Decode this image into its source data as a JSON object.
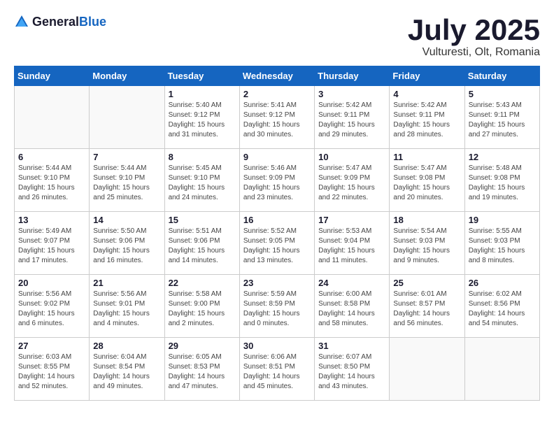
{
  "header": {
    "logo_general": "General",
    "logo_blue": "Blue",
    "month_title": "July 2025",
    "location": "Vulturesti, Olt, Romania"
  },
  "days_of_week": [
    "Sunday",
    "Monday",
    "Tuesday",
    "Wednesday",
    "Thursday",
    "Friday",
    "Saturday"
  ],
  "weeks": [
    [
      {
        "day": "",
        "info": ""
      },
      {
        "day": "",
        "info": ""
      },
      {
        "day": "1",
        "info": "Sunrise: 5:40 AM\nSunset: 9:12 PM\nDaylight: 15 hours\nand 31 minutes."
      },
      {
        "day": "2",
        "info": "Sunrise: 5:41 AM\nSunset: 9:12 PM\nDaylight: 15 hours\nand 30 minutes."
      },
      {
        "day": "3",
        "info": "Sunrise: 5:42 AM\nSunset: 9:11 PM\nDaylight: 15 hours\nand 29 minutes."
      },
      {
        "day": "4",
        "info": "Sunrise: 5:42 AM\nSunset: 9:11 PM\nDaylight: 15 hours\nand 28 minutes."
      },
      {
        "day": "5",
        "info": "Sunrise: 5:43 AM\nSunset: 9:11 PM\nDaylight: 15 hours\nand 27 minutes."
      }
    ],
    [
      {
        "day": "6",
        "info": "Sunrise: 5:44 AM\nSunset: 9:10 PM\nDaylight: 15 hours\nand 26 minutes."
      },
      {
        "day": "7",
        "info": "Sunrise: 5:44 AM\nSunset: 9:10 PM\nDaylight: 15 hours\nand 25 minutes."
      },
      {
        "day": "8",
        "info": "Sunrise: 5:45 AM\nSunset: 9:10 PM\nDaylight: 15 hours\nand 24 minutes."
      },
      {
        "day": "9",
        "info": "Sunrise: 5:46 AM\nSunset: 9:09 PM\nDaylight: 15 hours\nand 23 minutes."
      },
      {
        "day": "10",
        "info": "Sunrise: 5:47 AM\nSunset: 9:09 PM\nDaylight: 15 hours\nand 22 minutes."
      },
      {
        "day": "11",
        "info": "Sunrise: 5:47 AM\nSunset: 9:08 PM\nDaylight: 15 hours\nand 20 minutes."
      },
      {
        "day": "12",
        "info": "Sunrise: 5:48 AM\nSunset: 9:08 PM\nDaylight: 15 hours\nand 19 minutes."
      }
    ],
    [
      {
        "day": "13",
        "info": "Sunrise: 5:49 AM\nSunset: 9:07 PM\nDaylight: 15 hours\nand 17 minutes."
      },
      {
        "day": "14",
        "info": "Sunrise: 5:50 AM\nSunset: 9:06 PM\nDaylight: 15 hours\nand 16 minutes."
      },
      {
        "day": "15",
        "info": "Sunrise: 5:51 AM\nSunset: 9:06 PM\nDaylight: 15 hours\nand 14 minutes."
      },
      {
        "day": "16",
        "info": "Sunrise: 5:52 AM\nSunset: 9:05 PM\nDaylight: 15 hours\nand 13 minutes."
      },
      {
        "day": "17",
        "info": "Sunrise: 5:53 AM\nSunset: 9:04 PM\nDaylight: 15 hours\nand 11 minutes."
      },
      {
        "day": "18",
        "info": "Sunrise: 5:54 AM\nSunset: 9:03 PM\nDaylight: 15 hours\nand 9 minutes."
      },
      {
        "day": "19",
        "info": "Sunrise: 5:55 AM\nSunset: 9:03 PM\nDaylight: 15 hours\nand 8 minutes."
      }
    ],
    [
      {
        "day": "20",
        "info": "Sunrise: 5:56 AM\nSunset: 9:02 PM\nDaylight: 15 hours\nand 6 minutes."
      },
      {
        "day": "21",
        "info": "Sunrise: 5:56 AM\nSunset: 9:01 PM\nDaylight: 15 hours\nand 4 minutes."
      },
      {
        "day": "22",
        "info": "Sunrise: 5:58 AM\nSunset: 9:00 PM\nDaylight: 15 hours\nand 2 minutes."
      },
      {
        "day": "23",
        "info": "Sunrise: 5:59 AM\nSunset: 8:59 PM\nDaylight: 15 hours\nand 0 minutes."
      },
      {
        "day": "24",
        "info": "Sunrise: 6:00 AM\nSunset: 8:58 PM\nDaylight: 14 hours\nand 58 minutes."
      },
      {
        "day": "25",
        "info": "Sunrise: 6:01 AM\nSunset: 8:57 PM\nDaylight: 14 hours\nand 56 minutes."
      },
      {
        "day": "26",
        "info": "Sunrise: 6:02 AM\nSunset: 8:56 PM\nDaylight: 14 hours\nand 54 minutes."
      }
    ],
    [
      {
        "day": "27",
        "info": "Sunrise: 6:03 AM\nSunset: 8:55 PM\nDaylight: 14 hours\nand 52 minutes."
      },
      {
        "day": "28",
        "info": "Sunrise: 6:04 AM\nSunset: 8:54 PM\nDaylight: 14 hours\nand 49 minutes."
      },
      {
        "day": "29",
        "info": "Sunrise: 6:05 AM\nSunset: 8:53 PM\nDaylight: 14 hours\nand 47 minutes."
      },
      {
        "day": "30",
        "info": "Sunrise: 6:06 AM\nSunset: 8:51 PM\nDaylight: 14 hours\nand 45 minutes."
      },
      {
        "day": "31",
        "info": "Sunrise: 6:07 AM\nSunset: 8:50 PM\nDaylight: 14 hours\nand 43 minutes."
      },
      {
        "day": "",
        "info": ""
      },
      {
        "day": "",
        "info": ""
      }
    ]
  ]
}
